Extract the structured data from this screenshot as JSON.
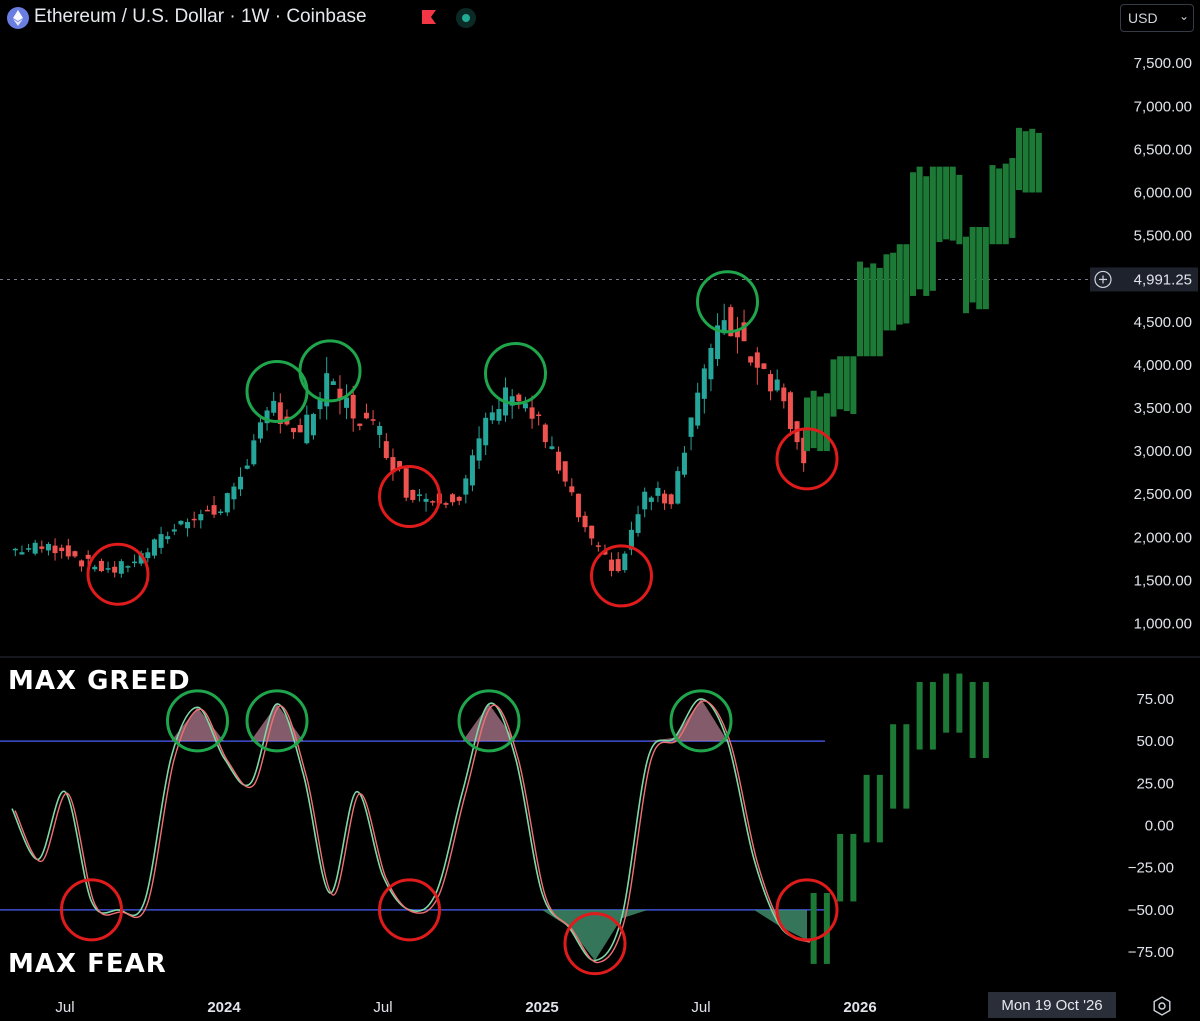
{
  "header": {
    "title": "Ethereum / U.S. Dollar · 1W · Coinbase",
    "icons": [
      "ethereum-logo-icon",
      "flag-icon",
      "market-status-icon"
    ],
    "currency": "USD"
  },
  "price_axis": {
    "ticks": [
      "7,500.00",
      "7,000.00",
      "6,500.00",
      "6,000.00",
      "5,500.00",
      "4,500.00",
      "4,000.00",
      "3,500.00",
      "3,000.00",
      "2,500.00",
      "2,000.00",
      "1,500.00",
      "1,000.00"
    ],
    "last_price_label": "4,991.25"
  },
  "oscillator_axis": {
    "ticks": [
      "75.00",
      "50.00",
      "25.00",
      "0.00",
      "−25.00",
      "−50.00",
      "−75.00"
    ]
  },
  "time_axis": {
    "ticks": [
      "Jul",
      "2024",
      "Jul",
      "2025",
      "Jul",
      "2026"
    ],
    "bold_ticks": [
      "2024",
      "2025",
      "2026"
    ],
    "crosshair_date": "Mon 19 Oct '26"
  },
  "annotations": {
    "greed_label": "MAX GREED",
    "fear_label": "MAX FEAR"
  },
  "colors": {
    "up": "#26a69a",
    "down": "#ef5350",
    "projection": "#1d7a36",
    "greed_circle": "#1fa54b",
    "fear_circle": "#e01b1b",
    "threshold_line": "#3f4fd4",
    "osc_line_a": "#7fd8a8",
    "osc_line_b": "#f07070"
  },
  "chart_data": [
    {
      "type": "candlestick",
      "title": "Ethereum / U.S. Dollar · 1W · Coinbase",
      "ylim": [
        700,
        7900
      ],
      "x_range": [
        "2023-05",
        "2026-10"
      ],
      "reference_line": 4991.25,
      "actual_series_approx_weekly_close": [
        [
          "2023-05",
          1850
        ],
        [
          "2023-06",
          1880
        ],
        [
          "2023-07",
          1880
        ],
        [
          "2023-08",
          1680
        ],
        [
          "2023-09",
          1620
        ],
        [
          "2023-10",
          1780
        ],
        [
          "2023-11",
          2050
        ],
        [
          "2023-12",
          2280
        ],
        [
          "2024-01",
          2300
        ],
        [
          "2024-02",
          2900
        ],
        [
          "2024-03",
          3550
        ],
        [
          "2024-04",
          3150
        ],
        [
          "2024-05",
          3780
        ],
        [
          "2024-06",
          3450
        ],
        [
          "2024-07",
          3200
        ],
        [
          "2024-08",
          2550
        ],
        [
          "2024-09",
          2450
        ],
        [
          "2024-10",
          2500
        ],
        [
          "2024-11",
          3300
        ],
        [
          "2024-12",
          3750
        ],
        [
          "2025-01",
          3300
        ],
        [
          "2025-02",
          2600
        ],
        [
          "2025-03",
          1900
        ],
        [
          "2025-04",
          1600
        ],
        [
          "2025-05",
          2500
        ],
        [
          "2025-06",
          2450
        ],
        [
          "2025-07",
          3700
        ],
        [
          "2025-08",
          4550
        ],
        [
          "2025-09",
          4150
        ],
        [
          "2025-10",
          3750
        ],
        [
          "2025-11",
          3000
        ]
      ],
      "projection_blocks": [
        {
          "x": "2025-11",
          "low": 3000,
          "high": 3700
        },
        {
          "x": "2025-12",
          "low": 3400,
          "high": 4100
        },
        {
          "x": "2026-01",
          "low": 4100,
          "high": 5200
        },
        {
          "x": "2026-02",
          "low": 4400,
          "high": 5400
        },
        {
          "x": "2026-03",
          "low": 4800,
          "high": 6300
        },
        {
          "x": "2026-04",
          "low": 5400,
          "high": 6300
        },
        {
          "x": "2026-05",
          "low": 4600,
          "high": 5600
        },
        {
          "x": "2026-06",
          "low": 5400,
          "high": 6400
        },
        {
          "x": "2026-07",
          "low": 6000,
          "high": 6750
        }
      ],
      "greed_circles_at": [
        "2024-03",
        "2024-05",
        "2024-12",
        "2025-08"
      ],
      "fear_circles_at": [
        "2023-09",
        "2024-08",
        "2025-04",
        "2025-11"
      ]
    },
    {
      "type": "line",
      "title": "",
      "ylim": [
        -90,
        90
      ],
      "thresholds": [
        50,
        -50
      ],
      "labels": {
        "upper": "MAX GREED",
        "lower": "MAX FEAR"
      },
      "series": [
        {
          "values": [
            [
              "2023-05",
              10
            ],
            [
              "2023-06",
              -20
            ],
            [
              "2023-07",
              20
            ],
            [
              "2023-08",
              -45
            ],
            [
              "2023-09",
              -50
            ],
            [
              "2023-10",
              -45
            ],
            [
              "2023-11",
              40
            ],
            [
              "2023-12",
              70
            ],
            [
              "2024-01",
              40
            ],
            [
              "2024-02",
              25
            ],
            [
              "2024-03",
              72
            ],
            [
              "2024-04",
              30
            ],
            [
              "2024-05",
              -40
            ],
            [
              "2024-06",
              20
            ],
            [
              "2024-07",
              -30
            ],
            [
              "2024-08",
              -50
            ],
            [
              "2024-09",
              -40
            ],
            [
              "2024-10",
              20
            ],
            [
              "2024-11",
              72
            ],
            [
              "2024-12",
              40
            ],
            [
              "2025-01",
              -40
            ],
            [
              "2025-02",
              -60
            ],
            [
              "2025-03",
              -80
            ],
            [
              "2025-04",
              -55
            ],
            [
              "2025-05",
              40
            ],
            [
              "2025-06",
              52
            ],
            [
              "2025-07",
              75
            ],
            [
              "2025-08",
              50
            ],
            [
              "2025-09",
              -20
            ],
            [
              "2025-10",
              -60
            ],
            [
              "2025-11",
              -68
            ]
          ]
        }
      ],
      "projection_blocks": [
        {
          "x": "2025-11",
          "low": -82,
          "high": -40
        },
        {
          "x": "2025-12",
          "low": -45,
          "high": -5
        },
        {
          "x": "2026-01",
          "low": -10,
          "high": 30
        },
        {
          "x": "2026-02",
          "low": 10,
          "high": 60
        },
        {
          "x": "2026-03",
          "low": 45,
          "high": 85
        },
        {
          "x": "2026-04",
          "low": 55,
          "high": 90
        },
        {
          "x": "2026-05",
          "low": 40,
          "high": 85
        }
      ],
      "greed_circles_at": [
        "2023-12",
        "2024-03",
        "2024-11",
        "2025-07"
      ],
      "fear_circles_at": [
        "2023-08",
        "2024-08",
        "2025-03",
        "2025-11"
      ]
    }
  ]
}
